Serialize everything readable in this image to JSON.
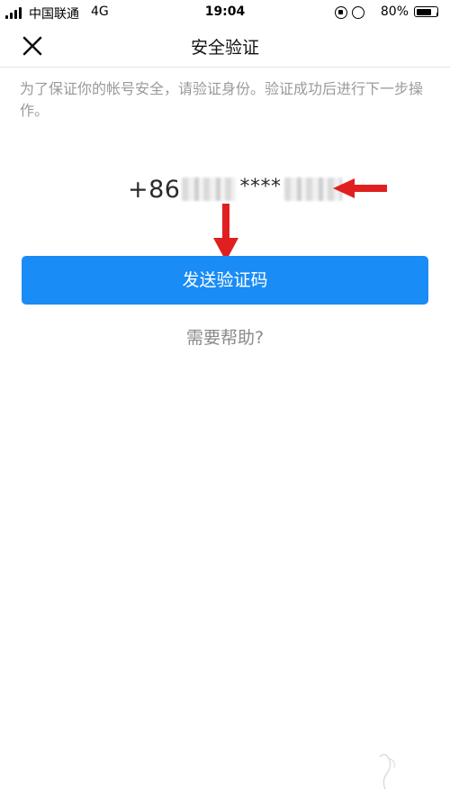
{
  "status_bar": {
    "carrier": "中国联通",
    "network": "4G",
    "time": "19:04",
    "battery_percent": "80%",
    "battery_level": 0.8,
    "icons": [
      "signal-icon",
      "rotation-lock-icon",
      "alarm-icon",
      "battery-icon"
    ]
  },
  "nav": {
    "title": "安全验证",
    "close_icon": "close-icon"
  },
  "main": {
    "description": "为了保证你的帐号安全，请验证身份。验证成功后进行下一步操作。",
    "phone": {
      "country_code": "+86",
      "masked_middle": "****"
    },
    "send_button_label": "发送验证码",
    "help_link_label": "需要帮助?"
  },
  "colors": {
    "primary_button": "#1a8cf5",
    "annotation_arrow": "#e02020",
    "description_text": "#9a9a9a"
  }
}
